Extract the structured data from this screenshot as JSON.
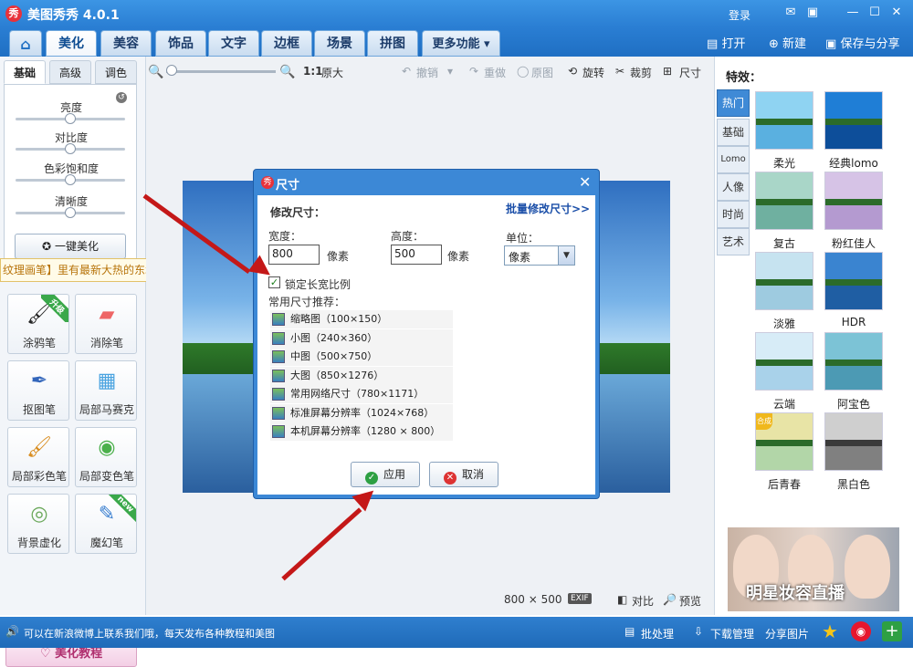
{
  "window": {
    "title": "美图秀秀 4.0.1",
    "logo": "秀",
    "login": "登录"
  },
  "tabs": [
    {
      "label": "美化"
    },
    {
      "label": "美容"
    },
    {
      "label": "饰品"
    },
    {
      "label": "文字"
    },
    {
      "label": "边框"
    },
    {
      "label": "场景"
    },
    {
      "label": "拼图"
    },
    {
      "label": "更多功能 ▾"
    }
  ],
  "header_actions": {
    "open": "打开",
    "new": "新建",
    "save_share": "保存与分享"
  },
  "left_panel": {
    "subtabs": [
      "基础",
      "高级",
      "调色"
    ],
    "sliders": [
      {
        "label": "亮度",
        "level": 0.5
      },
      {
        "label": "对比度",
        "level": 0.5
      },
      {
        "label": "色彩饱和度",
        "level": 0.5
      },
      {
        "label": "清晰度",
        "level": 0.5
      }
    ],
    "one_key": "一键美化",
    "tooltip": "纹理画笔】里有最新大热的东北大花素材哦，快来",
    "tools": [
      {
        "label": "涂鸦笔",
        "badge": "升级"
      },
      {
        "label": "消除笔",
        "badge": ""
      },
      {
        "label": "抠图笔",
        "badge": ""
      },
      {
        "label": "局部马赛克",
        "badge": ""
      },
      {
        "label": "局部彩色笔",
        "badge": ""
      },
      {
        "label": "局部变色笔",
        "badge": ""
      },
      {
        "label": "背景虚化",
        "badge": ""
      },
      {
        "label": "魔幻笔",
        "badge": "new"
      }
    ],
    "tutorial": "美化教程"
  },
  "canvas_toolbar": {
    "zoom_ratio": "1:1",
    "original_size": "原大",
    "undo": "撤销",
    "redo": "重做",
    "original": "原图",
    "rotate": "旋转",
    "crop": "裁剪",
    "resize": "尺寸"
  },
  "canvas_footer": {
    "dimensions": "800 × 500",
    "exif": "EXIF",
    "compare": "对比",
    "preview": "预览"
  },
  "dialog": {
    "logo": "秀",
    "title": "尺寸",
    "section": "修改尺寸：",
    "batch_link": "批量修改尺寸>>",
    "width_label": "宽度：",
    "width_value": "800",
    "height_label": "高度：",
    "height_value": "500",
    "pixel_unit": "像素",
    "unit_label": "单位：",
    "unit_value": "像素",
    "lock_ratio": "锁定长宽比例",
    "presets_title": "常用尺寸推荐：",
    "presets": [
      "缩略图（100×150）",
      "小图（240×360）",
      "中图（500×750）",
      "大图（850×1276）",
      "常用网络尺寸（780×1171）",
      "标准屏幕分辨率（1024×768）",
      "本机屏幕分辨率（1280 × 800）"
    ],
    "apply": "应用",
    "cancel": "取消"
  },
  "right_panel": {
    "title": "特效：",
    "vtabs": [
      "热门",
      "基础",
      "Lomo",
      "人像",
      "时尚",
      "艺术"
    ],
    "effects": [
      {
        "label": "柔光",
        "sky": "#8fd3f2",
        "water": "#5ab0e0",
        "badge": ""
      },
      {
        "label": "经典lomo",
        "sky": "#1f7ed6",
        "water": "#0d4e9a",
        "badge": ""
      },
      {
        "label": "复古",
        "sky": "#a9d6c8",
        "water": "#6fb0a0",
        "badge": ""
      },
      {
        "label": "粉红佳人",
        "sky": "#d6c3e6",
        "water": "#b49ad0",
        "badge": ""
      },
      {
        "label": "淡雅",
        "sky": "#c6e3f0",
        "water": "#9ecbe0",
        "badge": ""
      },
      {
        "label": "HDR",
        "sky": "#3a84d0",
        "water": "#1f5ea3",
        "badge": ""
      },
      {
        "label": "云端",
        "sky": "#d7ecf7",
        "water": "#a9d2ea",
        "badge": ""
      },
      {
        "label": "阿宝色",
        "sky": "#7cc3d6",
        "water": "#4c9ab4",
        "badge": ""
      },
      {
        "label": "后青春",
        "sky": "#e8e4a6",
        "water": "#b2d6a8",
        "badge": "合成"
      },
      {
        "label": "黑白色",
        "sky": "#cfcfcf",
        "water": "#808080",
        "badge": ""
      }
    ],
    "ad_text": "明星妆容直播"
  },
  "status": {
    "message": "可以在新浪微博上联系我们哦，每天发布各种教程和美图",
    "batch": "批处理",
    "download": "下载管理",
    "share": "分享图片"
  },
  "colors": {
    "accent": "#2a7ed3",
    "arrow": "#c41818",
    "batch_link": "#1a4ea8"
  }
}
